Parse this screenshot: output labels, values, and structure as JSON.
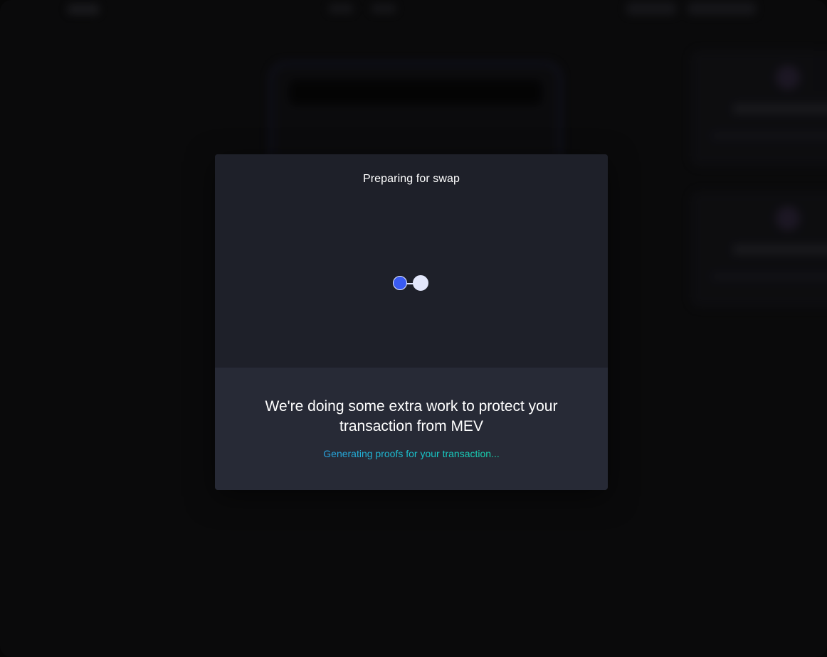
{
  "modal": {
    "title": "Preparing for swap",
    "message": "We're doing some extra work to protect your transaction from MEV",
    "status": "Generating proofs for your transaction...",
    "loader_icon": "loading-dots-icon"
  },
  "colors": {
    "page_background": "#0a0a0b",
    "modal_top": "#1e2029",
    "modal_bottom": "#272a36",
    "loader_blue": "#3a5bf2",
    "loader_light": "#e3e7fb",
    "status_gradient_start": "#3a7bf5",
    "status_gradient_end": "#1ee27a"
  }
}
